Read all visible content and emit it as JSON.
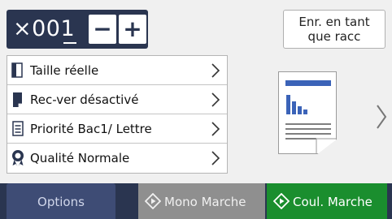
{
  "copies": {
    "value": "×001",
    "minus_icon": "minus-icon",
    "plus_icon": "plus-icon"
  },
  "shortcut": {
    "line1": "Enr. en tant",
    "line2": "que racc"
  },
  "settings": {
    "items": [
      {
        "label": "Taille réelle",
        "icon": "page-size-icon"
      },
      {
        "label": "Rec-ver désactivé",
        "icon": "duplex-icon"
      },
      {
        "label": "Priorité Bac1/ Lettre",
        "icon": "tray-icon"
      },
      {
        "label": "Qualité Normale",
        "icon": "quality-ribbon-icon"
      }
    ]
  },
  "preview": {
    "icon": "document-preview-icon",
    "next_icon": "chevron-right-icon"
  },
  "bottom": {
    "options": "Options",
    "mono_start": "Mono Marche",
    "color_start": "Coul. Marche"
  },
  "colors": {
    "navy": "#2a3550",
    "options": "#3e4c75",
    "mono": "#8f8f8f",
    "color_start": "#1a8e2e",
    "accent_blue": "#3b63b8"
  }
}
